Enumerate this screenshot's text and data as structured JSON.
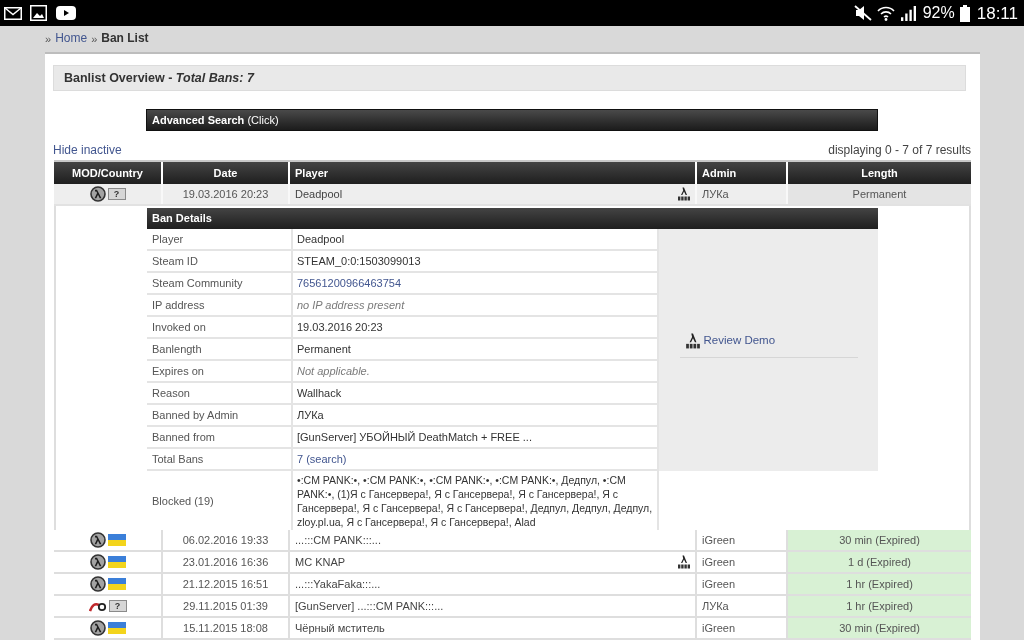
{
  "status_bar": {
    "battery": "92%",
    "time": "18:11"
  },
  "breadcrumb": {
    "separator": "»",
    "items": [
      {
        "label": "Home",
        "current": false
      },
      {
        "label": "Ban List",
        "current": true
      }
    ]
  },
  "overview": {
    "title": "Banlist Overview - *Total Bans: 7*"
  },
  "advanced_search": "**Advanced Search** (Click)",
  "hide_inactive": "Hide inactive",
  "results_info": "displaying 0 - 7 of 7 results",
  "table": {
    "columns": [
      "MOD/Country",
      "Date",
      "Player",
      "Admin",
      "Length"
    ],
    "rows": [
      {
        "mod": {
          "kind": "lambda"
        },
        "flag": {
          "kind": "unknown",
          "text": "?"
        },
        "date": "19.03.2016 20:23",
        "player": "Deadpool",
        "demo": true,
        "admin": "ЛУКа",
        "length": "Permanent",
        "expired": false,
        "expanded": true,
        "details": {
          "title": "Ban Details",
          "fields": [
            {
              "label": "Player",
              "value": "Deadpool",
              "kind": "text"
            },
            {
              "label": "Steam ID",
              "value": "STEAM_0:0:1503099013",
              "kind": "text"
            },
            {
              "label": "Steam Community",
              "value": "76561200966463754",
              "kind": "link"
            },
            {
              "label": "IP address",
              "value": "no IP address present",
              "kind": "note"
            },
            {
              "label": "Invoked on",
              "value": "19.03.2016 20:23",
              "kind": "text"
            },
            {
              "label": "Banlength",
              "value": "Permanent",
              "kind": "text"
            },
            {
              "label": "Expires on",
              "value": "Not applicable.",
              "kind": "note"
            },
            {
              "label": "Reason",
              "value": "Wallhack",
              "kind": "text"
            },
            {
              "label": "Banned by Admin",
              "value": "ЛУКа",
              "kind": "text"
            },
            {
              "label": "Banned from",
              "value": "[GunServer] УБОЙНЫЙ DeathMatch + FREE ...",
              "kind": "text"
            },
            {
              "label": "Total Bans",
              "value": "7 (search)",
              "kind": "link"
            }
          ],
          "blocked": {
            "label": "Blocked (19)",
            "value": "•:CM PANK:•, •:CM PANK:•, •:CM PANK:•, •:CM PANK:•, Дедпул, •:CM PANK:•, (1)Я с Гансервера!, Я с Гансервера!, Я с Гансервера!, Я с Гансервера!, Я с Гансервера!, Я с Гансервера!, Дедпул, Дедпул, Дедпул, zloy.pl.ua, Я с Гансервера!, Я с Гансервера!, Alad"
          },
          "review_demo": "Review Demo"
        }
      },
      {
        "mod": {
          "kind": "lambda"
        },
        "flag": {
          "kind": "ukraine"
        },
        "date": "06.02.2016 19:33",
        "player": "...:::CM PANK:::...",
        "demo": false,
        "admin": "iGreen",
        "length": "30 min (Expired)",
        "expired": true,
        "expanded": false
      },
      {
        "mod": {
          "kind": "lambda"
        },
        "flag": {
          "kind": "ukraine"
        },
        "date": "23.01.2016 16:36",
        "player": "MC KNAP",
        "demo": true,
        "admin": "iGreen",
        "length": "1 d (Expired)",
        "expired": true,
        "expanded": false
      },
      {
        "mod": {
          "kind": "lambda"
        },
        "flag": {
          "kind": "ukraine"
        },
        "date": "21.12.2015 16:51",
        "player": "...:::YakaFaka:::...",
        "demo": false,
        "admin": "iGreen",
        "length": "1 hr (Expired)",
        "expired": true,
        "expanded": false
      },
      {
        "mod": {
          "kind": "swirl"
        },
        "flag": {
          "kind": "unknown",
          "text": "?"
        },
        "date": "29.11.2015 01:39",
        "player": "[GunServer] ...:::CM PANK:::...",
        "demo": false,
        "admin": "ЛУКа",
        "length": "1 hr (Expired)",
        "expired": true,
        "expanded": false
      },
      {
        "mod": {
          "kind": "lambda"
        },
        "flag": {
          "kind": "ukraine"
        },
        "date": "15.11.2015 18:08",
        "player": "Чёрный мститель",
        "demo": false,
        "admin": "iGreen",
        "length": "30 min (Expired)",
        "expired": true,
        "expanded": false
      }
    ]
  }
}
